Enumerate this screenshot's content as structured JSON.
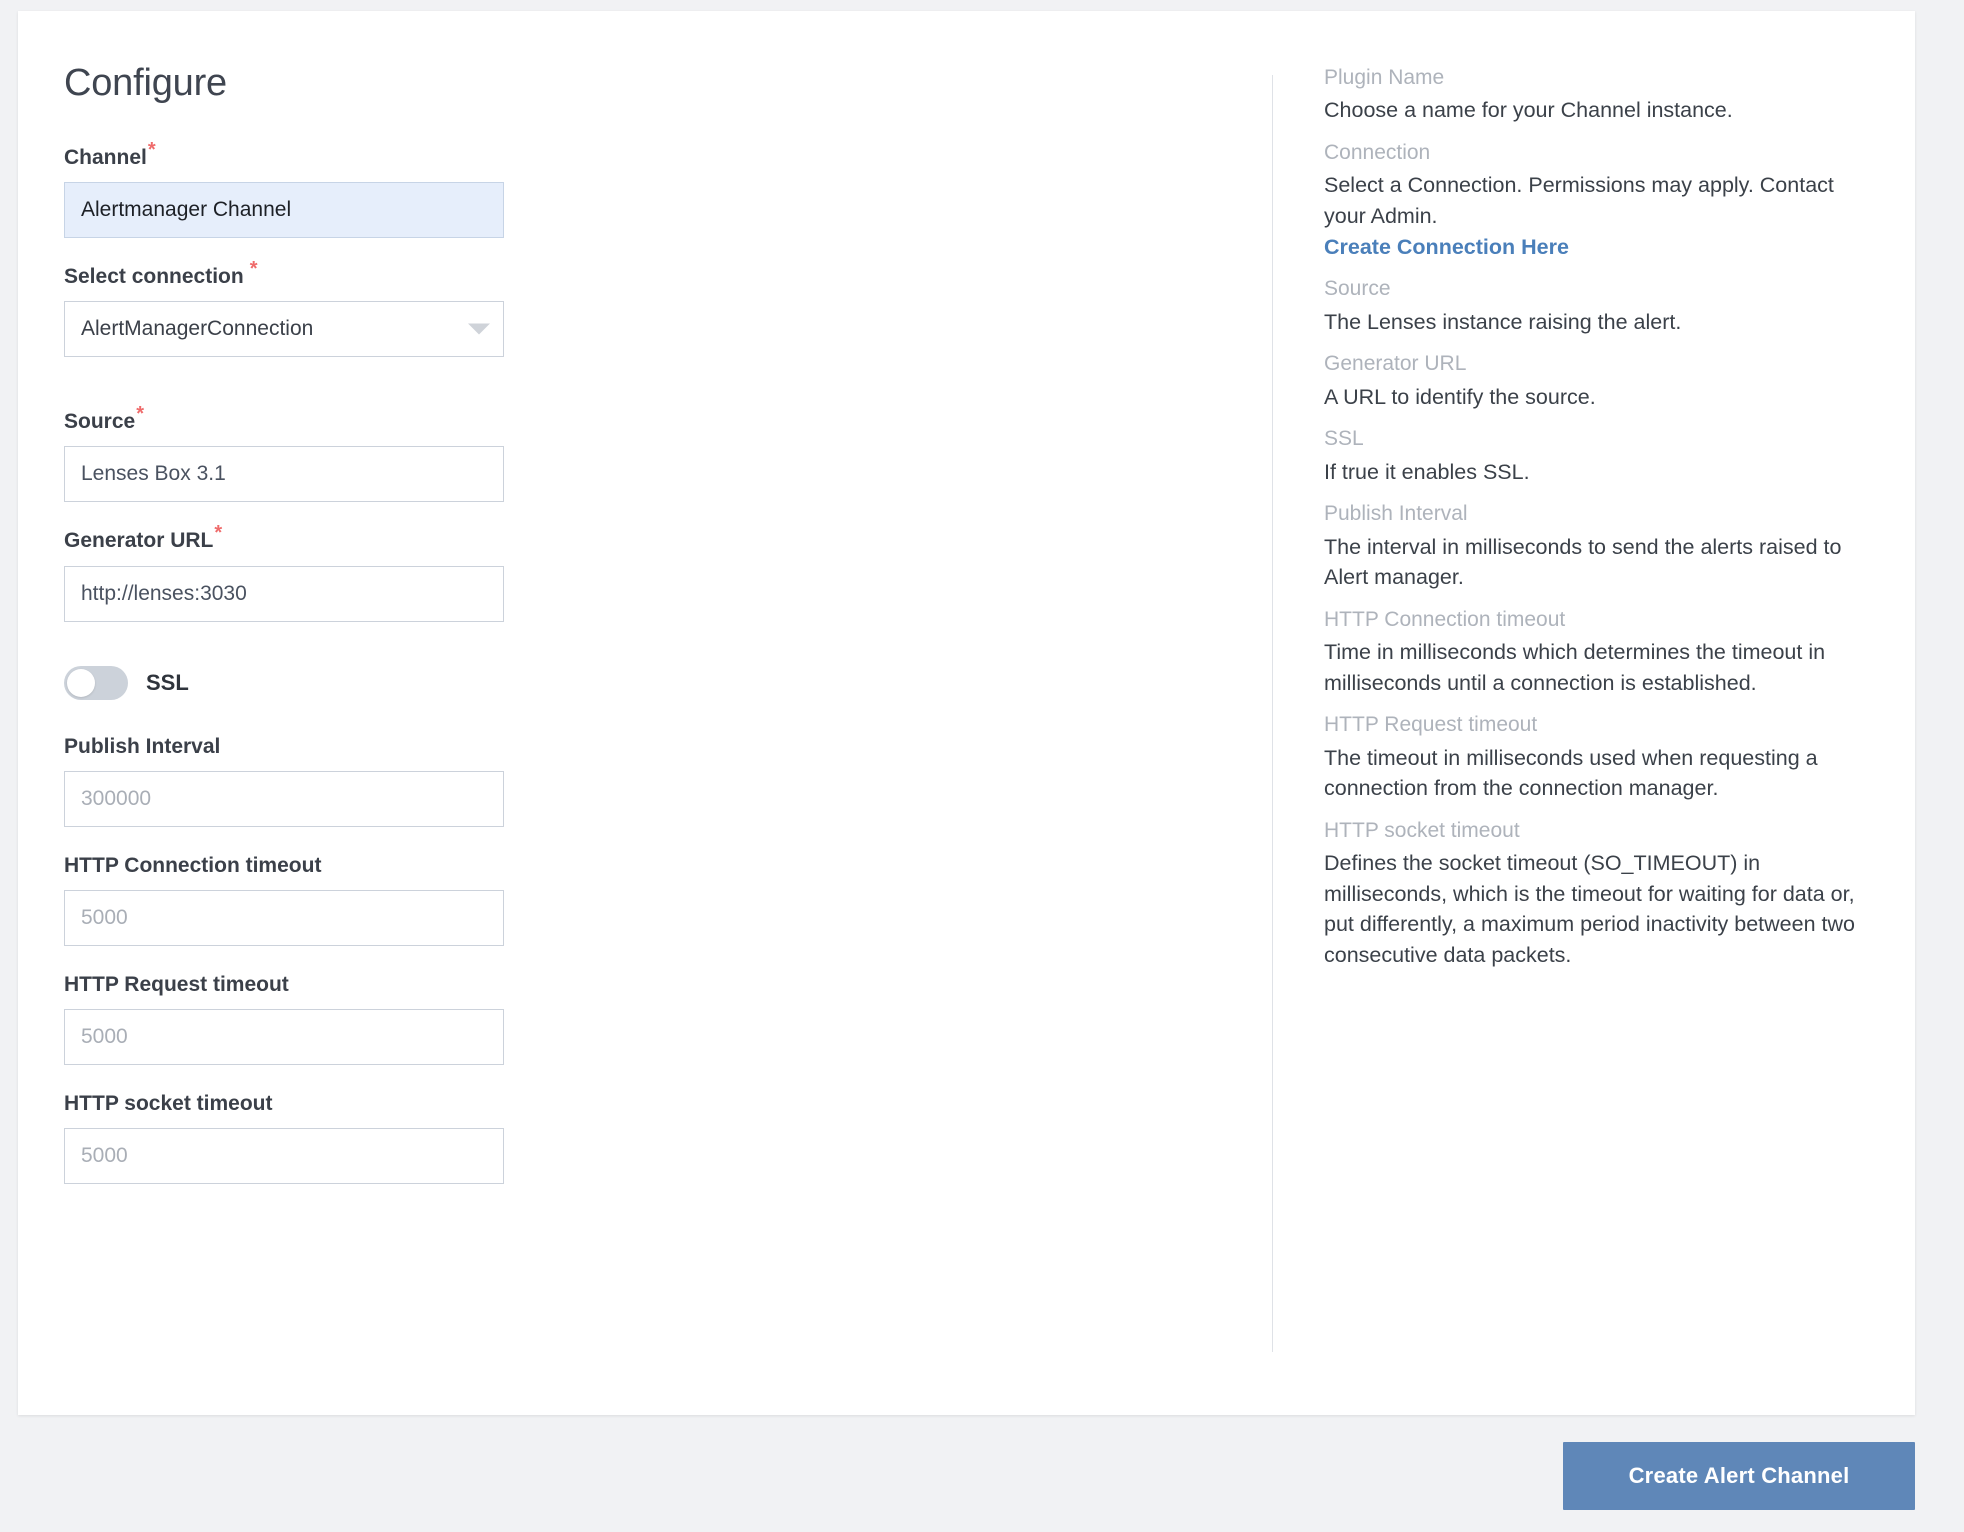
{
  "page": {
    "title": "Configure"
  },
  "form": {
    "fields": [
      {
        "label": "Channel",
        "required": true,
        "value": "Alertmanager Channel",
        "placeholder": "Channel",
        "type": "text"
      },
      {
        "label": "Select connection",
        "required": true,
        "value": "AlertManagerConnection",
        "type": "select"
      },
      {
        "label": "Source",
        "required": true,
        "value": "Lenses Box 3.1",
        "placeholder": "Source",
        "type": "text"
      },
      {
        "label": "Generator URL",
        "required": true,
        "value": "http://lenses:3030",
        "placeholder": "Generator URL",
        "type": "text"
      },
      {
        "label": "Publish Interval",
        "required": false,
        "value": "",
        "placeholder": "300000",
        "type": "text"
      },
      {
        "label": "HTTP Connection timeout",
        "required": false,
        "value": "",
        "placeholder": "5000",
        "type": "text"
      },
      {
        "label": "HTTP Request timeout",
        "required": false,
        "value": "",
        "placeholder": "5000",
        "type": "text"
      },
      {
        "label": "HTTP socket timeout",
        "required": false,
        "value": "",
        "placeholder": "5000",
        "type": "text"
      }
    ],
    "ssl_toggle": {
      "label": "SSL",
      "state": "off"
    },
    "required_marker": "*"
  },
  "help": {
    "items": [
      {
        "term": "Plugin Name",
        "desc": "Choose a name for your Channel instance."
      },
      {
        "term": "Connection",
        "desc": "Select a Connection. Permissions may apply. Contact your Admin.",
        "link": "Create Connection Here"
      },
      {
        "term": "Source",
        "desc": "The Lenses instance raising the alert."
      },
      {
        "term": "Generator URL",
        "desc": "A URL to identify the source."
      },
      {
        "term": "SSL",
        "desc": "If true it enables SSL."
      },
      {
        "term": "Publish Interval",
        "desc": "The interval in milliseconds to send the alerts raised to Alert manager."
      },
      {
        "term": "HTTP Connection timeout",
        "desc": "Time in milliseconds which determines the timeout in milliseconds until a connection is established."
      },
      {
        "term": "HTTP Request timeout",
        "desc": "The timeout in milliseconds used when requesting a connection from the connection manager."
      },
      {
        "term": "HTTP socket timeout",
        "desc": "Defines the socket timeout (SO_TIMEOUT) in milliseconds, which is the timeout for waiting for data or, put differently, a maximum period inactivity between two consecutive data packets."
      }
    ]
  },
  "footer": {
    "submit_label": "Create Alert Channel"
  },
  "colors": {
    "accent": "#5f87b8",
    "link": "#4a7fba",
    "required": "#ef6b6b",
    "input_highlight_bg": "#e6eefb",
    "page_bg": "#f1f2f4"
  }
}
